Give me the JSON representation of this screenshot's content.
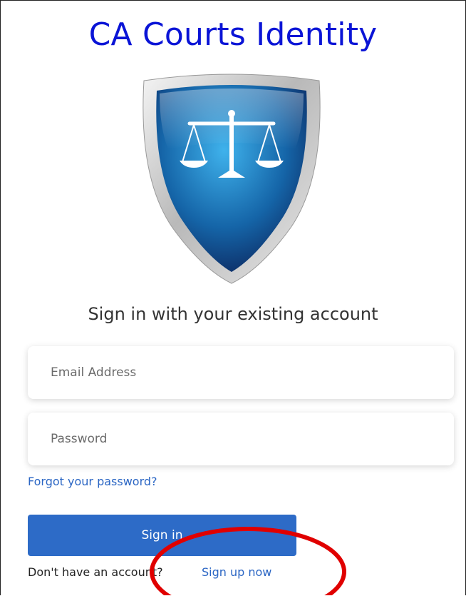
{
  "header": {
    "title": "CA Courts Identity"
  },
  "logo": {
    "icon": "scales-of-justice-shield-icon"
  },
  "form": {
    "heading": "Sign in with your existing account",
    "email_placeholder": "Email Address",
    "password_placeholder": "Password",
    "forgot_label": "Forgot your password?",
    "signin_label": "Sign in",
    "no_account_label": "Don't have an account?",
    "signup_label": "Sign up now"
  },
  "colors": {
    "title": "#0a14d6",
    "primary_button": "#2d6bc7",
    "link": "#2b66c4",
    "annotation": "#e00000"
  }
}
